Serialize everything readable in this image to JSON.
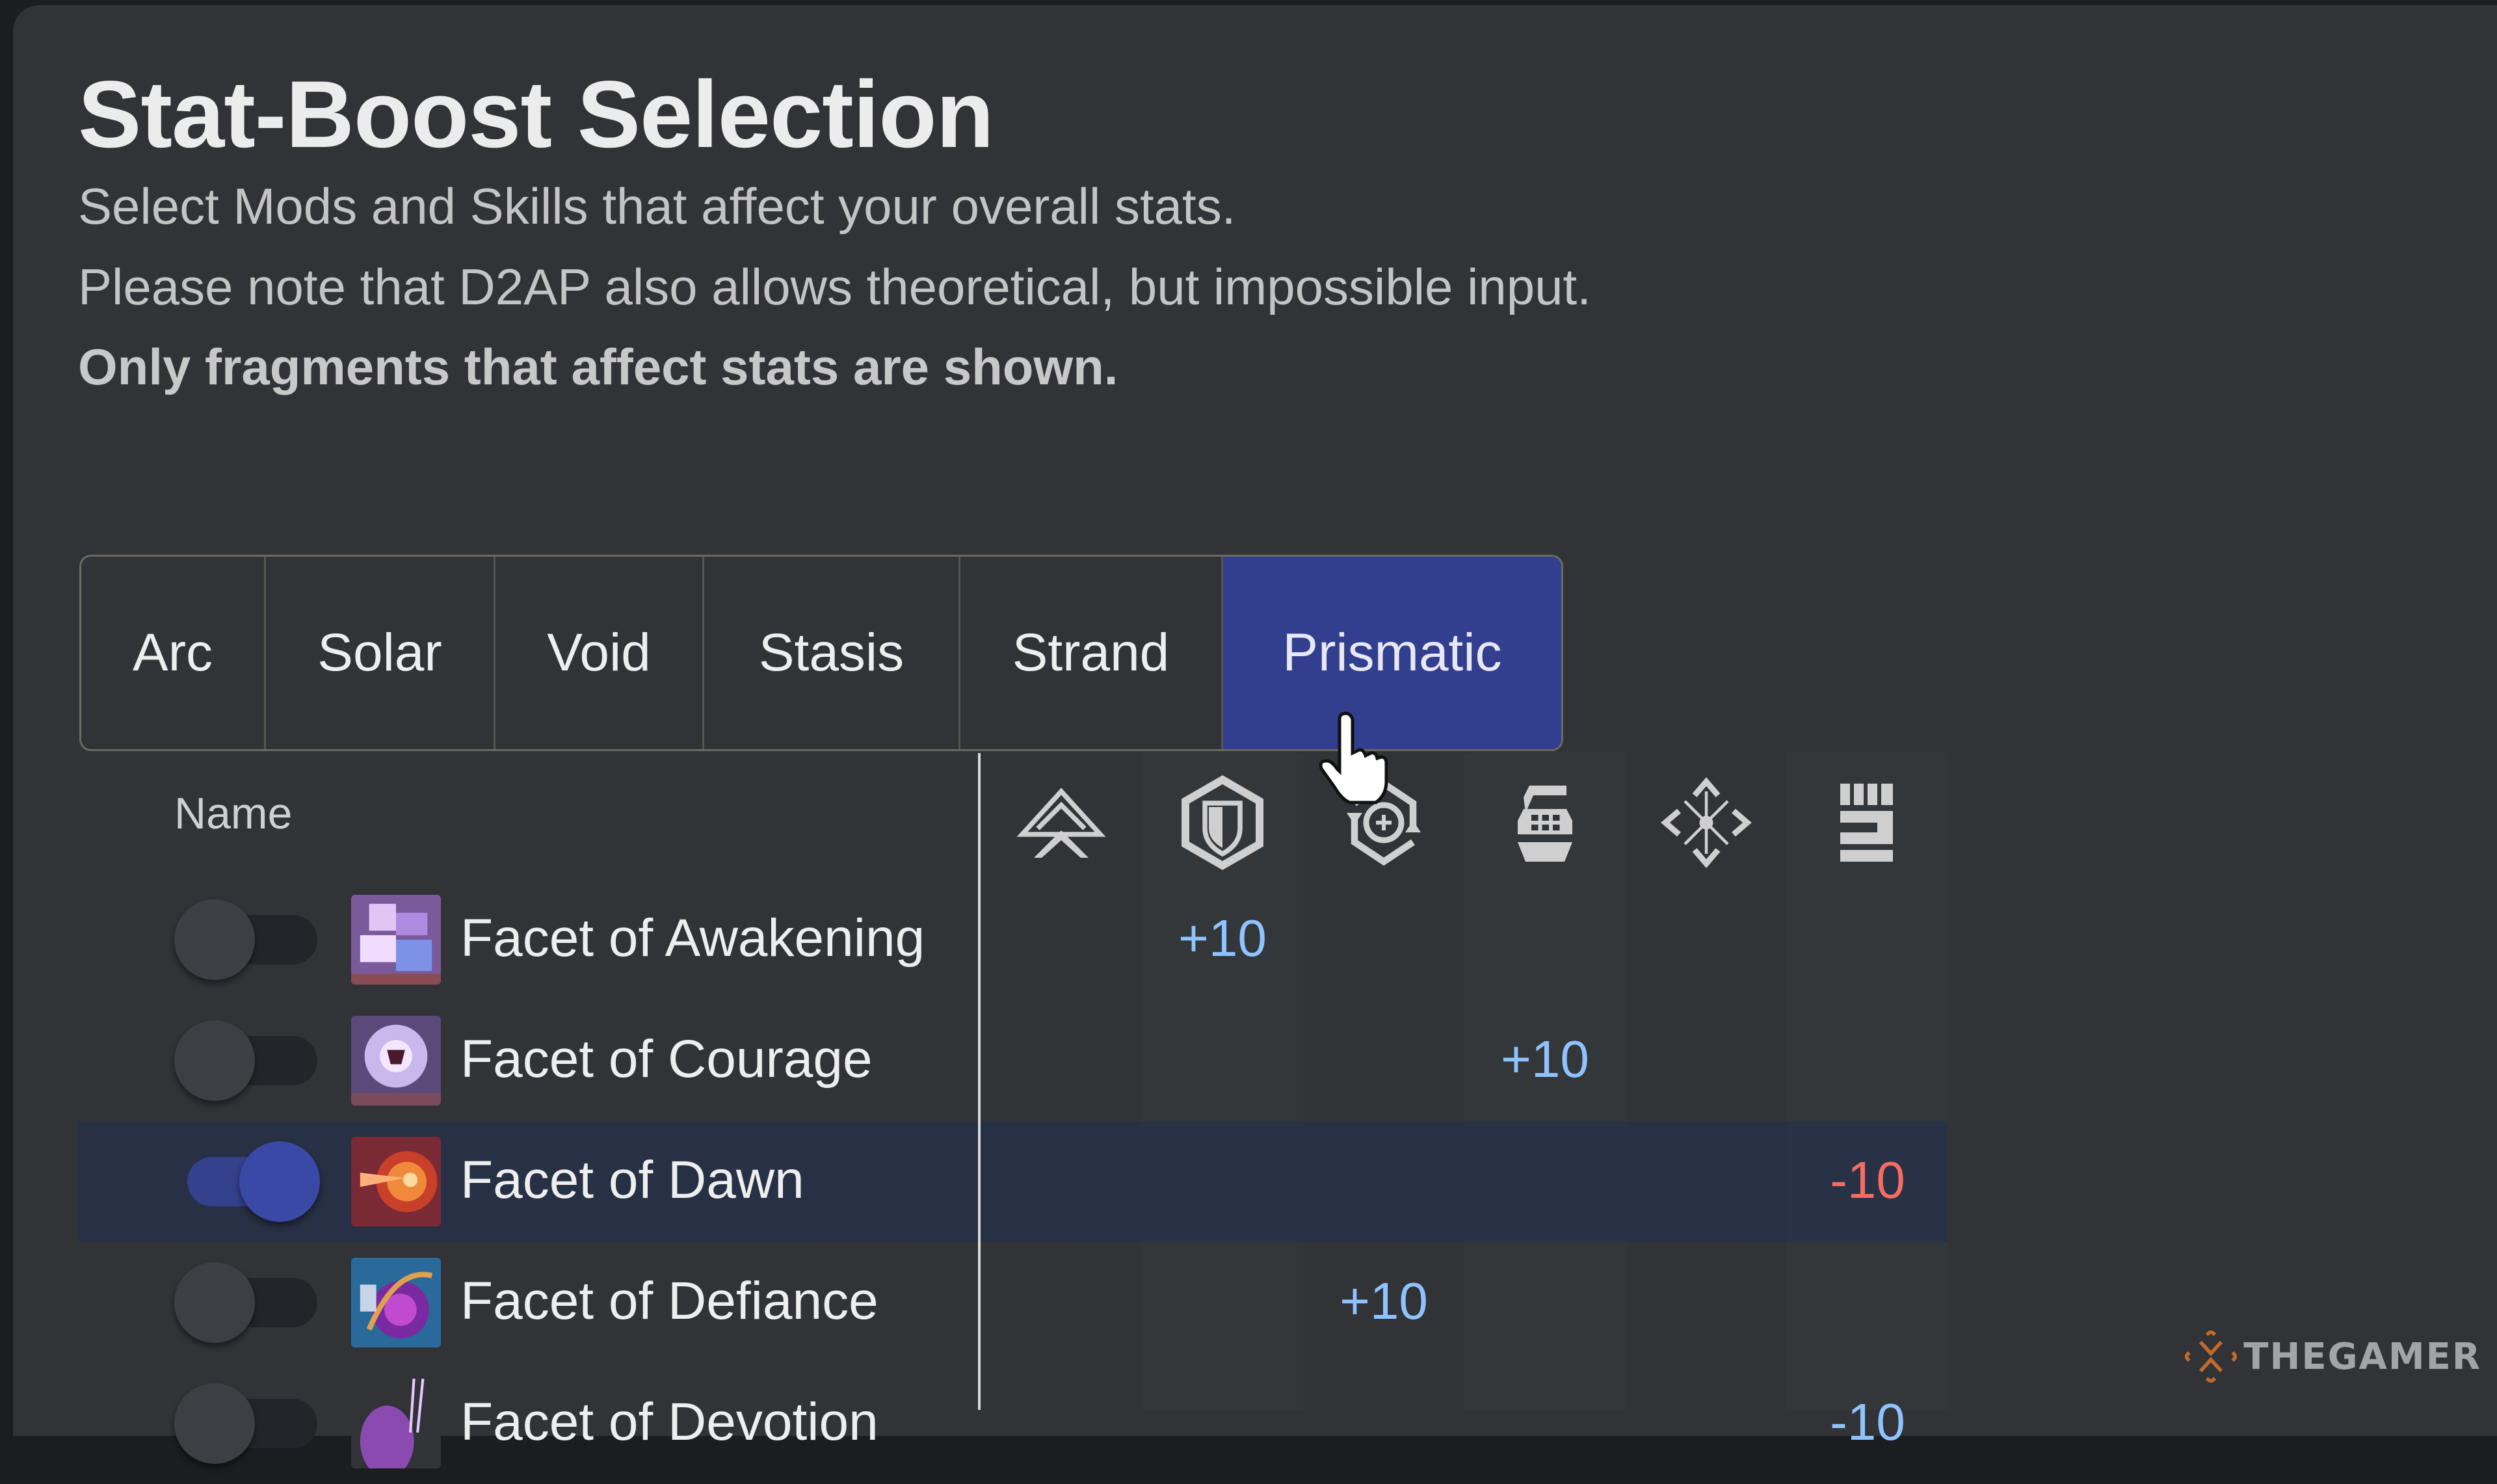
{
  "header": {
    "title": "Stat-Boost Selection",
    "subtitle_lines": [
      "Select Mods and Skills that affect your overall stats.",
      "Please note that D2AP also allows theoretical, but impossible input."
    ],
    "note": "Only fragments that affect stats are shown."
  },
  "tabs": [
    {
      "label": "Arc",
      "active": false
    },
    {
      "label": "Solar",
      "active": false
    },
    {
      "label": "Void",
      "active": false
    },
    {
      "label": "Stasis",
      "active": false
    },
    {
      "label": "Strand",
      "active": false
    },
    {
      "label": "Prismatic",
      "active": true
    }
  ],
  "table": {
    "name_header": "Name",
    "stat_columns": [
      {
        "icon": "mobility-icon"
      },
      {
        "icon": "resilience-icon"
      },
      {
        "icon": "recovery-icon"
      },
      {
        "icon": "discipline-icon"
      },
      {
        "icon": "intellect-icon"
      },
      {
        "icon": "strength-icon"
      }
    ],
    "rows": [
      {
        "name": "Facet of Awakening",
        "enabled": false,
        "values": [
          "",
          "+10",
          "",
          "",
          "",
          ""
        ]
      },
      {
        "name": "Facet of Courage",
        "enabled": false,
        "values": [
          "",
          "",
          "",
          "+10",
          "",
          ""
        ]
      },
      {
        "name": "Facet of Dawn",
        "enabled": true,
        "values": [
          "",
          "",
          "",
          "",
          "",
          "-10"
        ]
      },
      {
        "name": "Facet of Defiance",
        "enabled": false,
        "values": [
          "",
          "",
          "+10",
          "",
          "",
          ""
        ]
      },
      {
        "name": "Facet of Devotion",
        "enabled": false,
        "values": [
          "",
          "",
          "",
          "",
          "",
          "-10"
        ]
      }
    ]
  },
  "colors": {
    "accent": "#323f8e",
    "positive": "#8fc3ff",
    "negative": "#f56c62",
    "background": "#313337"
  },
  "watermark": "THEGAMER"
}
